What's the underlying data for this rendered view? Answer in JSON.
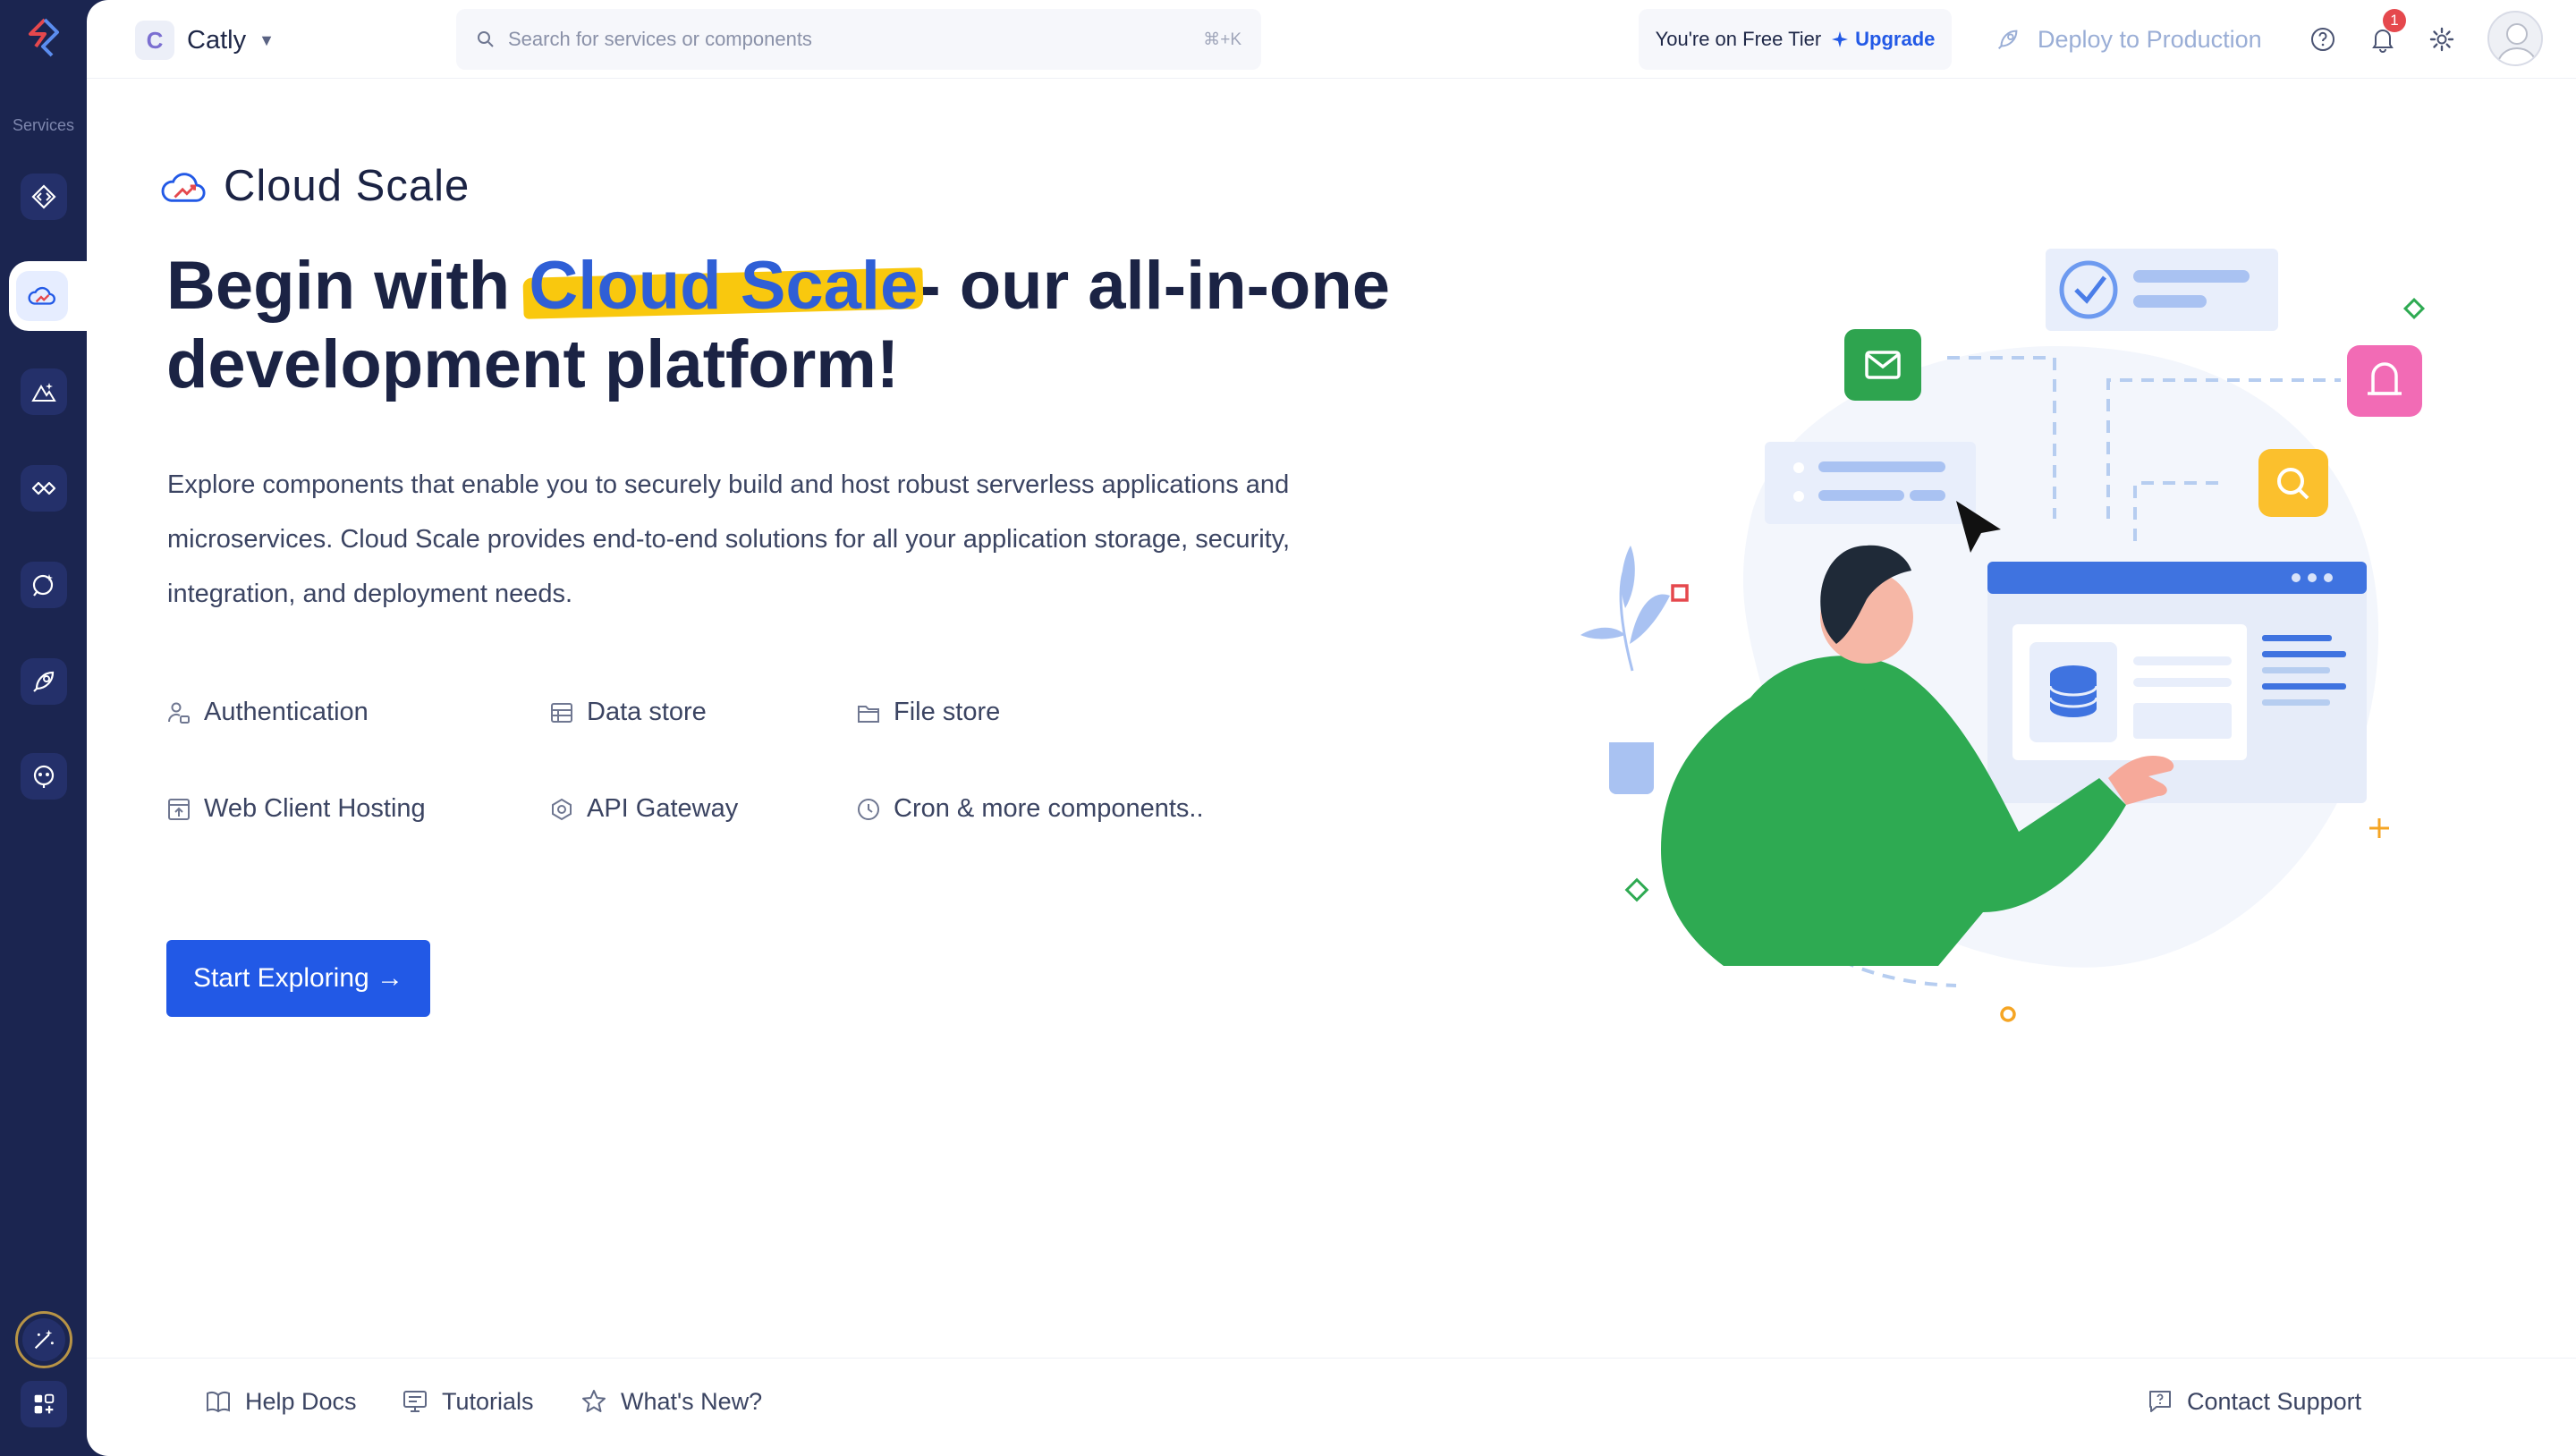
{
  "sidebar": {
    "label": "Services",
    "items": [
      {
        "icon": "code-brackets-icon"
      },
      {
        "icon": "cloud-scale-icon",
        "active": true
      },
      {
        "icon": "mountain-ai-icon"
      },
      {
        "icon": "infinity-icon"
      },
      {
        "icon": "chat-sparkle-icon"
      },
      {
        "icon": "rocket-icon"
      },
      {
        "icon": "robot-face-icon"
      }
    ],
    "bottom": [
      {
        "icon": "magic-wand-icon"
      },
      {
        "icon": "apps-grid-icon"
      }
    ]
  },
  "topbar": {
    "org_initial": "C",
    "org_name": "Catly",
    "search_placeholder": "Search for services or components",
    "search_shortcut": "⌘+K",
    "tier_text": "You're on Free Tier",
    "upgrade_label": "Upgrade",
    "deploy_label": "Deploy to Production",
    "notification_count": "1"
  },
  "page": {
    "title": "Cloud Scale",
    "hero_prefix": "Begin with ",
    "hero_highlight": "Cloud Scale",
    "hero_suffix": "- our all-in-one development platform!",
    "description": "Explore components that enable you to securely build and host robust serverless applications and microservices. Cloud Scale provides end-to-end solutions for all your application storage, security, integration, and deployment needs.",
    "features": [
      {
        "label": "Authentication",
        "icon": "user-lock-icon"
      },
      {
        "label": "Data store",
        "icon": "table-icon"
      },
      {
        "label": "File store",
        "icon": "folder-icon"
      },
      {
        "label": "Web Client Hosting",
        "icon": "web-upload-icon"
      },
      {
        "label": "API Gateway",
        "icon": "gateway-icon"
      },
      {
        "label": "Cron & more components..",
        "icon": "clock-icon"
      }
    ],
    "cta_label": "Start Exploring →"
  },
  "footer": {
    "help_docs": "Help Docs",
    "tutorials": "Tutorials",
    "whats_new": "What's New?",
    "contact_support": "Contact Support"
  },
  "colors": {
    "sidebar": "#1b2550",
    "primary": "#2259e6",
    "highlight": "#f9c80e",
    "text": "#1b2344"
  }
}
